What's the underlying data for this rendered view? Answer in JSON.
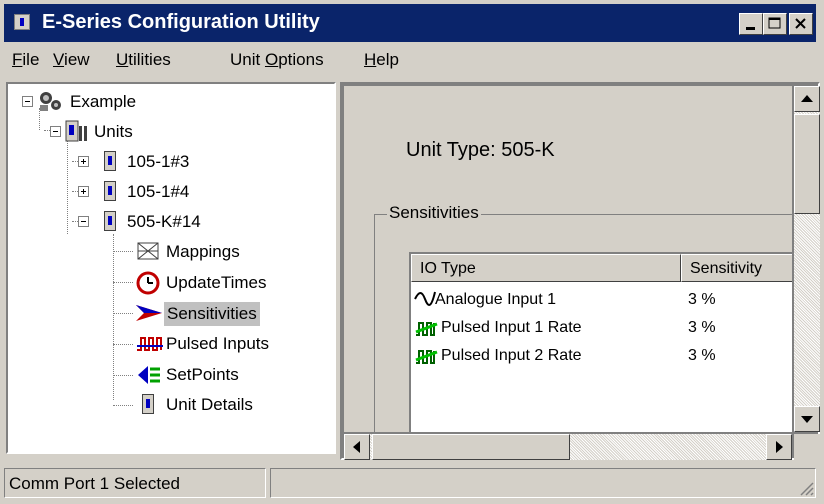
{
  "window": {
    "title": "E-Series Configuration Utility"
  },
  "menu": {
    "items": [
      {
        "label": "File",
        "mnemonic": "F",
        "rest": "ile"
      },
      {
        "label": "View",
        "mnemonic": "V",
        "rest": "iew"
      },
      {
        "label": "Utilities",
        "mnemonic": "U",
        "rest": "tilities"
      },
      {
        "label": "Unit Options",
        "pre": "Unit ",
        "mnemonic": "O",
        "rest": "ptions"
      },
      {
        "label": "Help",
        "mnemonic": "H",
        "rest": "elp"
      }
    ]
  },
  "tree": {
    "root": "Example",
    "units_folder": "Units",
    "units": [
      "105-1#3",
      "105-1#4",
      "505-K#14"
    ],
    "children": [
      "Mappings",
      "UpdateTimes",
      "Sensitivities",
      "Pulsed Inputs",
      "SetPoints",
      "Unit Details"
    ],
    "selected": "Sensitivities"
  },
  "detail": {
    "unit_type": "Unit Type: 505-K",
    "group_label": "Sensitivities",
    "columns": [
      "IO Type",
      "Sensitivity"
    ],
    "rows": [
      {
        "io_type": "Analogue Input 1",
        "sensitivity": "3 %",
        "icon": "sine-wave-icon"
      },
      {
        "io_type": "Pulsed Input 1 Rate",
        "sensitivity": "3 %",
        "icon": "pulse-rate-icon"
      },
      {
        "io_type": "Pulsed Input 2 Rate",
        "sensitivity": "3 %",
        "icon": "pulse-rate-icon"
      }
    ]
  },
  "status": {
    "text": "Comm Port 1 Selected"
  },
  "colors": {
    "titlebar": "#0a246a",
    "selection": "#c0c0c0",
    "face": "#d4d0c8"
  }
}
